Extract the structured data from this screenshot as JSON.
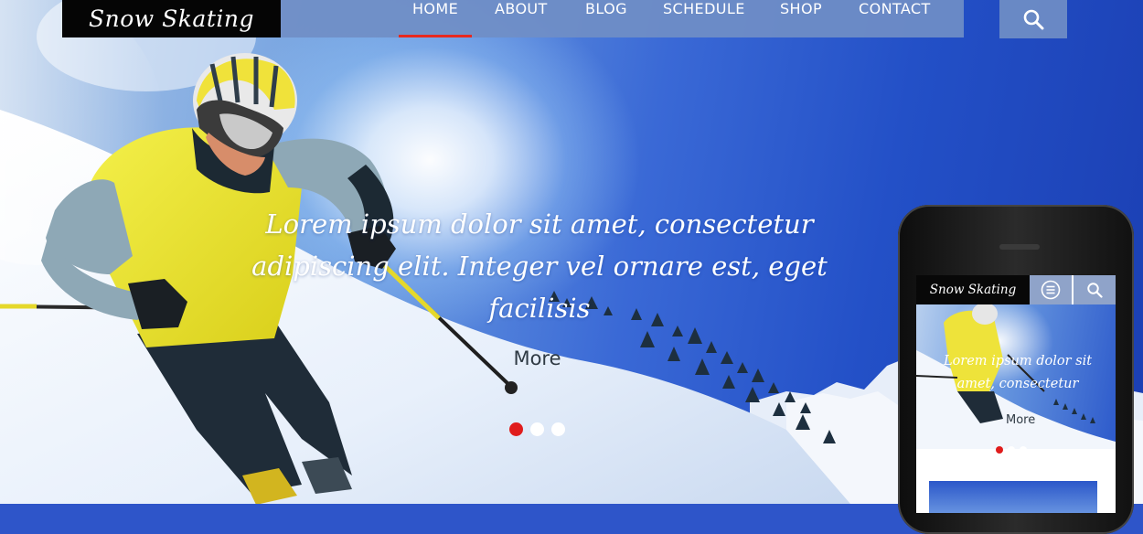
{
  "brand": {
    "logo_text": "Snow Skating"
  },
  "nav": {
    "items": [
      {
        "label": "HOME",
        "active": true
      },
      {
        "label": "ABOUT",
        "active": false
      },
      {
        "label": "BLOG",
        "active": false
      },
      {
        "label": "SCHEDULE",
        "active": false
      },
      {
        "label": "SHOP",
        "active": false
      },
      {
        "label": "CONTACT",
        "active": false
      }
    ],
    "search_icon": "search-icon"
  },
  "hero": {
    "caption": "Lorem ipsum dolor sit amet, consectetur adipiscing elit. Integer vel ornare est, eget facilisis",
    "more_label": "More",
    "slide_count": 3,
    "active_slide": 1
  },
  "phone": {
    "logo_text": "Snow Skating",
    "menu_icon": "menu-icon",
    "search_icon": "search-icon",
    "caption": "Lorem ipsum dolor sit amet, consectetur",
    "more_label": "More"
  },
  "colors": {
    "accent": "#e8291f",
    "nav_bg": "#708ec6",
    "logo_bg": "#050505"
  }
}
